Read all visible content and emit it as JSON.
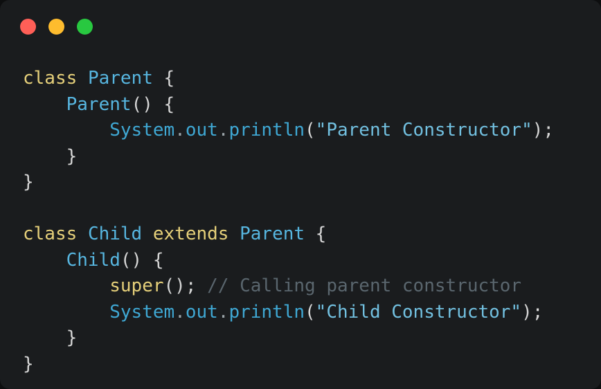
{
  "window": {
    "name": "code-snippet-window",
    "background": "#1a1c1e",
    "page_background": "#0d0e0f",
    "traffic_lights": [
      {
        "name": "close",
        "color": "#ff5f57"
      },
      {
        "name": "minimize",
        "color": "#febc2e"
      },
      {
        "name": "maximize",
        "color": "#28c840"
      }
    ]
  },
  "theme": {
    "keyword": "#e6d07a",
    "type": "#57b6e0",
    "punctuation": "#d6d6d6",
    "function": "#3fa8d4",
    "string": "#72c0e0",
    "comment": "#5a666e"
  },
  "code": {
    "language": "java",
    "lines": [
      {
        "n": 1,
        "indent": 0,
        "text": "class Parent {",
        "tokens": [
          {
            "t": "class",
            "k": "keyword"
          },
          {
            "t": " ",
            "k": "plain"
          },
          {
            "t": "Parent",
            "k": "type"
          },
          {
            "t": " {",
            "k": "punct"
          }
        ]
      },
      {
        "n": 2,
        "indent": 1,
        "text": "    Parent() {",
        "tokens": [
          {
            "t": "Parent",
            "k": "type"
          },
          {
            "t": "() {",
            "k": "punct"
          }
        ]
      },
      {
        "n": 3,
        "indent": 2,
        "text": "        System.out.println(\"Parent Constructor\");",
        "tokens": [
          {
            "t": "System",
            "k": "fn"
          },
          {
            "t": ".",
            "k": "dot"
          },
          {
            "t": "out",
            "k": "fn"
          },
          {
            "t": ".",
            "k": "dot"
          },
          {
            "t": "println",
            "k": "fn"
          },
          {
            "t": "(",
            "k": "punct"
          },
          {
            "t": "\"Parent Constructor\"",
            "k": "string"
          },
          {
            "t": ");",
            "k": "punct"
          }
        ]
      },
      {
        "n": 4,
        "indent": 1,
        "text": "    }",
        "tokens": [
          {
            "t": "}",
            "k": "punct"
          }
        ]
      },
      {
        "n": 5,
        "indent": 0,
        "text": "}",
        "tokens": [
          {
            "t": "}",
            "k": "punct"
          }
        ]
      },
      {
        "n": 6,
        "indent": 0,
        "text": "",
        "tokens": []
      },
      {
        "n": 7,
        "indent": 0,
        "text": "class Child extends Parent {",
        "tokens": [
          {
            "t": "class",
            "k": "keyword"
          },
          {
            "t": " ",
            "k": "plain"
          },
          {
            "t": "Child",
            "k": "type"
          },
          {
            "t": " ",
            "k": "plain"
          },
          {
            "t": "extends",
            "k": "keyword"
          },
          {
            "t": " ",
            "k": "plain"
          },
          {
            "t": "Parent",
            "k": "type"
          },
          {
            "t": " {",
            "k": "punct"
          }
        ]
      },
      {
        "n": 8,
        "indent": 1,
        "text": "    Child() {",
        "tokens": [
          {
            "t": "Child",
            "k": "type"
          },
          {
            "t": "() {",
            "k": "punct"
          }
        ]
      },
      {
        "n": 9,
        "indent": 2,
        "text": "        super(); // Calling parent constructor",
        "tokens": [
          {
            "t": "super",
            "k": "keyword"
          },
          {
            "t": "(); ",
            "k": "punct"
          },
          {
            "t": "// Calling parent constructor",
            "k": "comment"
          }
        ]
      },
      {
        "n": 10,
        "indent": 2,
        "text": "        System.out.println(\"Child Constructor\");",
        "tokens": [
          {
            "t": "System",
            "k": "fn"
          },
          {
            "t": ".",
            "k": "dot"
          },
          {
            "t": "out",
            "k": "fn"
          },
          {
            "t": ".",
            "k": "dot"
          },
          {
            "t": "println",
            "k": "fn"
          },
          {
            "t": "(",
            "k": "punct"
          },
          {
            "t": "\"Child Constructor\"",
            "k": "string"
          },
          {
            "t": ");",
            "k": "punct"
          }
        ]
      },
      {
        "n": 11,
        "indent": 1,
        "text": "    }",
        "tokens": [
          {
            "t": "}",
            "k": "punct"
          }
        ]
      },
      {
        "n": 12,
        "indent": 0,
        "text": "}",
        "tokens": [
          {
            "t": "}",
            "k": "punct"
          }
        ]
      }
    ]
  }
}
